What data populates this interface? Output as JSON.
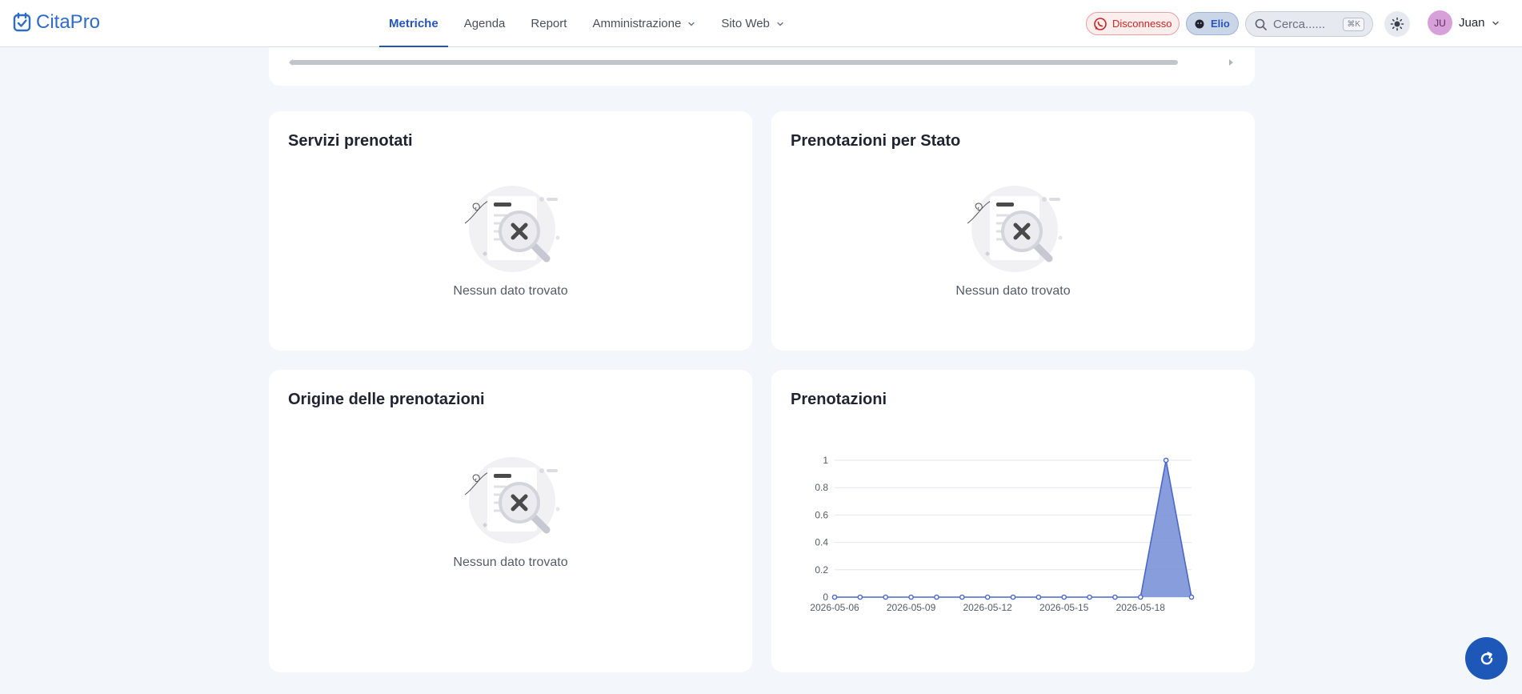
{
  "app": {
    "name": "CitaPro"
  },
  "nav": {
    "items": [
      {
        "label": "Metriche",
        "active": true,
        "dropdown": false
      },
      {
        "label": "Agenda",
        "active": false,
        "dropdown": false
      },
      {
        "label": "Report",
        "active": false,
        "dropdown": false
      },
      {
        "label": "Amministrazione",
        "active": false,
        "dropdown": true
      },
      {
        "label": "Sito Web",
        "active": false,
        "dropdown": true
      }
    ]
  },
  "header": {
    "whatsapp_status": "Disconnesso",
    "staff_label": "Elio",
    "search_placeholder": "Cerca......",
    "search_shortcut": "⌘K",
    "user_initials": "JU",
    "user_name": "Juan"
  },
  "cards": {
    "services": {
      "title": "Servizi prenotati",
      "empty_text": "Nessun dato trovato"
    },
    "status": {
      "title": "Prenotazioni per Stato",
      "empty_text": "Nessun dato trovato"
    },
    "origin": {
      "title": "Origine delle prenotazioni",
      "empty_text": "Nessun dato trovato"
    },
    "bookings": {
      "title": "Prenotazioni"
    }
  },
  "colors": {
    "accent": "#2455b8",
    "series_fill": "#7b94d8",
    "series_line": "#4a67c9",
    "disconnected": "#cc2222"
  },
  "chart_data": {
    "type": "area",
    "title": "Prenotazioni",
    "x": [
      "2026-05-06",
      "2026-05-07",
      "2026-05-08",
      "2026-05-09",
      "2026-05-10",
      "2026-05-11",
      "2026-05-12",
      "2026-05-13",
      "2026-05-14",
      "2026-05-15",
      "2026-05-16",
      "2026-05-17",
      "2026-05-18",
      "2026-05-19",
      "2026-05-20"
    ],
    "x_tick_labels": [
      "2026-05-06",
      "2026-05-09",
      "2026-05-12",
      "2026-05-15",
      "2026-05-18"
    ],
    "series": [
      {
        "values": [
          0,
          0,
          0,
          0,
          0,
          0,
          0,
          0,
          0,
          0,
          0,
          0,
          0,
          1,
          0
        ]
      }
    ],
    "y_ticks": [
      "0",
      "0.2",
      "0.4",
      "0.6",
      "0.8",
      "1"
    ],
    "ylim": [
      0,
      1
    ],
    "xlabel": "",
    "ylabel": "",
    "grid": true,
    "legend": "none"
  }
}
